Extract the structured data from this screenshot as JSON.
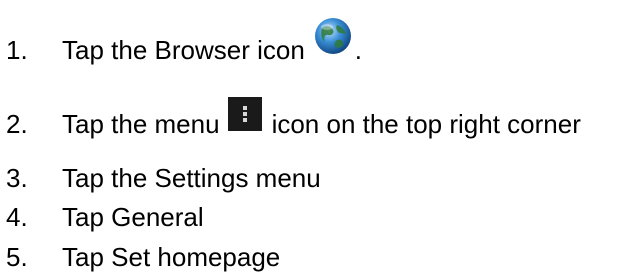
{
  "steps": [
    {
      "number": "1.",
      "text_before": "Tap the Browser icon",
      "icon": "browser-globe-icon",
      "text_after": "."
    },
    {
      "number": "2.",
      "text_before": "Tap the menu",
      "icon": "overflow-menu-icon",
      "text_after": "icon on the top right corner"
    },
    {
      "number": "3.",
      "text": "Tap the Settings menu"
    },
    {
      "number": "4.",
      "text": "Tap General"
    },
    {
      "number": "5.",
      "text": "Tap Set homepage"
    }
  ],
  "colors": {
    "text": "#000000",
    "background": "#ffffff",
    "menu_icon_bg": "#1a1a1a",
    "globe_blue": "#3a8fd6"
  }
}
